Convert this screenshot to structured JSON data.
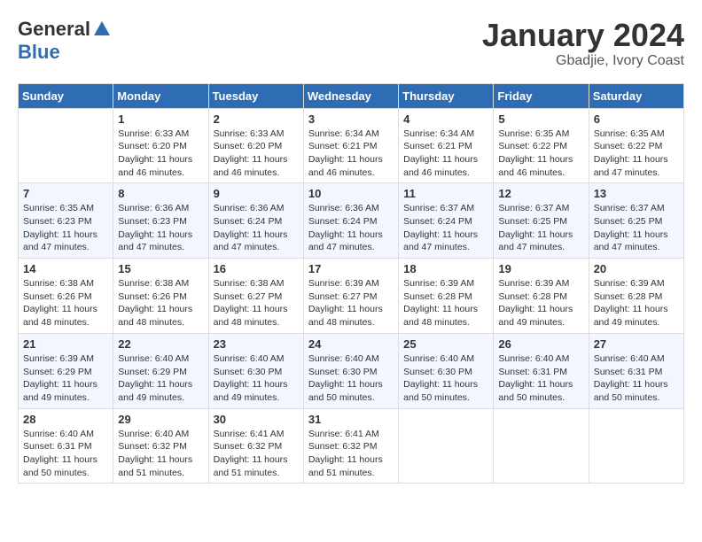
{
  "header": {
    "logo_general": "General",
    "logo_blue": "Blue",
    "month_title": "January 2024",
    "location": "Gbadjie, Ivory Coast"
  },
  "days_of_week": [
    "Sunday",
    "Monday",
    "Tuesday",
    "Wednesday",
    "Thursday",
    "Friday",
    "Saturday"
  ],
  "weeks": [
    [
      {
        "date": "",
        "sunrise": "",
        "sunset": "",
        "daylight": ""
      },
      {
        "date": "1",
        "sunrise": "Sunrise: 6:33 AM",
        "sunset": "Sunset: 6:20 PM",
        "daylight": "Daylight: 11 hours and 46 minutes."
      },
      {
        "date": "2",
        "sunrise": "Sunrise: 6:33 AM",
        "sunset": "Sunset: 6:20 PM",
        "daylight": "Daylight: 11 hours and 46 minutes."
      },
      {
        "date": "3",
        "sunrise": "Sunrise: 6:34 AM",
        "sunset": "Sunset: 6:21 PM",
        "daylight": "Daylight: 11 hours and 46 minutes."
      },
      {
        "date": "4",
        "sunrise": "Sunrise: 6:34 AM",
        "sunset": "Sunset: 6:21 PM",
        "daylight": "Daylight: 11 hours and 46 minutes."
      },
      {
        "date": "5",
        "sunrise": "Sunrise: 6:35 AM",
        "sunset": "Sunset: 6:22 PM",
        "daylight": "Daylight: 11 hours and 46 minutes."
      },
      {
        "date": "6",
        "sunrise": "Sunrise: 6:35 AM",
        "sunset": "Sunset: 6:22 PM",
        "daylight": "Daylight: 11 hours and 47 minutes."
      }
    ],
    [
      {
        "date": "7",
        "sunrise": "Sunrise: 6:35 AM",
        "sunset": "Sunset: 6:23 PM",
        "daylight": "Daylight: 11 hours and 47 minutes."
      },
      {
        "date": "8",
        "sunrise": "Sunrise: 6:36 AM",
        "sunset": "Sunset: 6:23 PM",
        "daylight": "Daylight: 11 hours and 47 minutes."
      },
      {
        "date": "9",
        "sunrise": "Sunrise: 6:36 AM",
        "sunset": "Sunset: 6:24 PM",
        "daylight": "Daylight: 11 hours and 47 minutes."
      },
      {
        "date": "10",
        "sunrise": "Sunrise: 6:36 AM",
        "sunset": "Sunset: 6:24 PM",
        "daylight": "Daylight: 11 hours and 47 minutes."
      },
      {
        "date": "11",
        "sunrise": "Sunrise: 6:37 AM",
        "sunset": "Sunset: 6:24 PM",
        "daylight": "Daylight: 11 hours and 47 minutes."
      },
      {
        "date": "12",
        "sunrise": "Sunrise: 6:37 AM",
        "sunset": "Sunset: 6:25 PM",
        "daylight": "Daylight: 11 hours and 47 minutes."
      },
      {
        "date": "13",
        "sunrise": "Sunrise: 6:37 AM",
        "sunset": "Sunset: 6:25 PM",
        "daylight": "Daylight: 11 hours and 47 minutes."
      }
    ],
    [
      {
        "date": "14",
        "sunrise": "Sunrise: 6:38 AM",
        "sunset": "Sunset: 6:26 PM",
        "daylight": "Daylight: 11 hours and 48 minutes."
      },
      {
        "date": "15",
        "sunrise": "Sunrise: 6:38 AM",
        "sunset": "Sunset: 6:26 PM",
        "daylight": "Daylight: 11 hours and 48 minutes."
      },
      {
        "date": "16",
        "sunrise": "Sunrise: 6:38 AM",
        "sunset": "Sunset: 6:27 PM",
        "daylight": "Daylight: 11 hours and 48 minutes."
      },
      {
        "date": "17",
        "sunrise": "Sunrise: 6:39 AM",
        "sunset": "Sunset: 6:27 PM",
        "daylight": "Daylight: 11 hours and 48 minutes."
      },
      {
        "date": "18",
        "sunrise": "Sunrise: 6:39 AM",
        "sunset": "Sunset: 6:28 PM",
        "daylight": "Daylight: 11 hours and 48 minutes."
      },
      {
        "date": "19",
        "sunrise": "Sunrise: 6:39 AM",
        "sunset": "Sunset: 6:28 PM",
        "daylight": "Daylight: 11 hours and 49 minutes."
      },
      {
        "date": "20",
        "sunrise": "Sunrise: 6:39 AM",
        "sunset": "Sunset: 6:28 PM",
        "daylight": "Daylight: 11 hours and 49 minutes."
      }
    ],
    [
      {
        "date": "21",
        "sunrise": "Sunrise: 6:39 AM",
        "sunset": "Sunset: 6:29 PM",
        "daylight": "Daylight: 11 hours and 49 minutes."
      },
      {
        "date": "22",
        "sunrise": "Sunrise: 6:40 AM",
        "sunset": "Sunset: 6:29 PM",
        "daylight": "Daylight: 11 hours and 49 minutes."
      },
      {
        "date": "23",
        "sunrise": "Sunrise: 6:40 AM",
        "sunset": "Sunset: 6:30 PM",
        "daylight": "Daylight: 11 hours and 49 minutes."
      },
      {
        "date": "24",
        "sunrise": "Sunrise: 6:40 AM",
        "sunset": "Sunset: 6:30 PM",
        "daylight": "Daylight: 11 hours and 50 minutes."
      },
      {
        "date": "25",
        "sunrise": "Sunrise: 6:40 AM",
        "sunset": "Sunset: 6:30 PM",
        "daylight": "Daylight: 11 hours and 50 minutes."
      },
      {
        "date": "26",
        "sunrise": "Sunrise: 6:40 AM",
        "sunset": "Sunset: 6:31 PM",
        "daylight": "Daylight: 11 hours and 50 minutes."
      },
      {
        "date": "27",
        "sunrise": "Sunrise: 6:40 AM",
        "sunset": "Sunset: 6:31 PM",
        "daylight": "Daylight: 11 hours and 50 minutes."
      }
    ],
    [
      {
        "date": "28",
        "sunrise": "Sunrise: 6:40 AM",
        "sunset": "Sunset: 6:31 PM",
        "daylight": "Daylight: 11 hours and 50 minutes."
      },
      {
        "date": "29",
        "sunrise": "Sunrise: 6:40 AM",
        "sunset": "Sunset: 6:32 PM",
        "daylight": "Daylight: 11 hours and 51 minutes."
      },
      {
        "date": "30",
        "sunrise": "Sunrise: 6:41 AM",
        "sunset": "Sunset: 6:32 PM",
        "daylight": "Daylight: 11 hours and 51 minutes."
      },
      {
        "date": "31",
        "sunrise": "Sunrise: 6:41 AM",
        "sunset": "Sunset: 6:32 PM",
        "daylight": "Daylight: 11 hours and 51 minutes."
      },
      {
        "date": "",
        "sunrise": "",
        "sunset": "",
        "daylight": ""
      },
      {
        "date": "",
        "sunrise": "",
        "sunset": "",
        "daylight": ""
      },
      {
        "date": "",
        "sunrise": "",
        "sunset": "",
        "daylight": ""
      }
    ]
  ]
}
